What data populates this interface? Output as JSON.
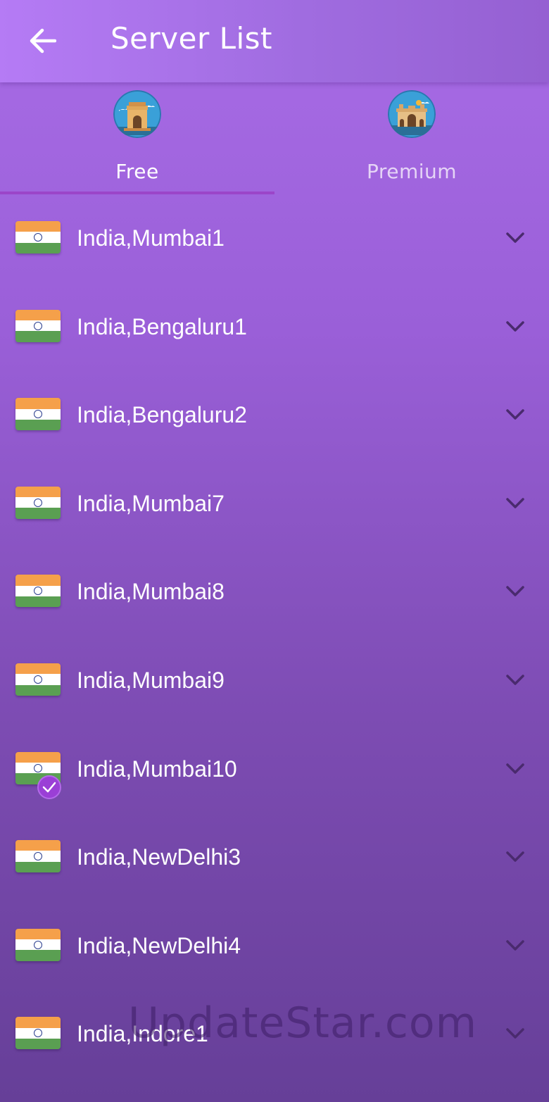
{
  "appbar": {
    "title": "Server List"
  },
  "tabs": [
    {
      "label": "Free",
      "selected": true,
      "icon": "india-gate-icon"
    },
    {
      "label": "Premium",
      "selected": false,
      "icon": "gateway-of-india-icon"
    }
  ],
  "servers": [
    {
      "name": "India,Mumbai1",
      "flag": "india-flag-icon",
      "selected": false
    },
    {
      "name": "India,Bengaluru1",
      "flag": "india-flag-icon",
      "selected": false
    },
    {
      "name": "India,Bengaluru2",
      "flag": "india-flag-icon",
      "selected": false
    },
    {
      "name": "India,Mumbai7",
      "flag": "india-flag-icon",
      "selected": false
    },
    {
      "name": "India,Mumbai8",
      "flag": "india-flag-icon",
      "selected": false
    },
    {
      "name": "India,Mumbai9",
      "flag": "india-flag-icon",
      "selected": false
    },
    {
      "name": "India,Mumbai10",
      "flag": "india-flag-icon",
      "selected": true
    },
    {
      "name": "India,NewDelhi3",
      "flag": "india-flag-icon",
      "selected": false
    },
    {
      "name": "India,NewDelhi4",
      "flag": "india-flag-icon",
      "selected": false
    },
    {
      "name": "India,Indore1",
      "flag": "india-flag-icon",
      "selected": false
    }
  ],
  "watermark": "UpdateStar.com",
  "colors": {
    "accent": "#9b45c9",
    "chevron": "#4a2a6e",
    "selected_badge": "#9a3fd6"
  }
}
